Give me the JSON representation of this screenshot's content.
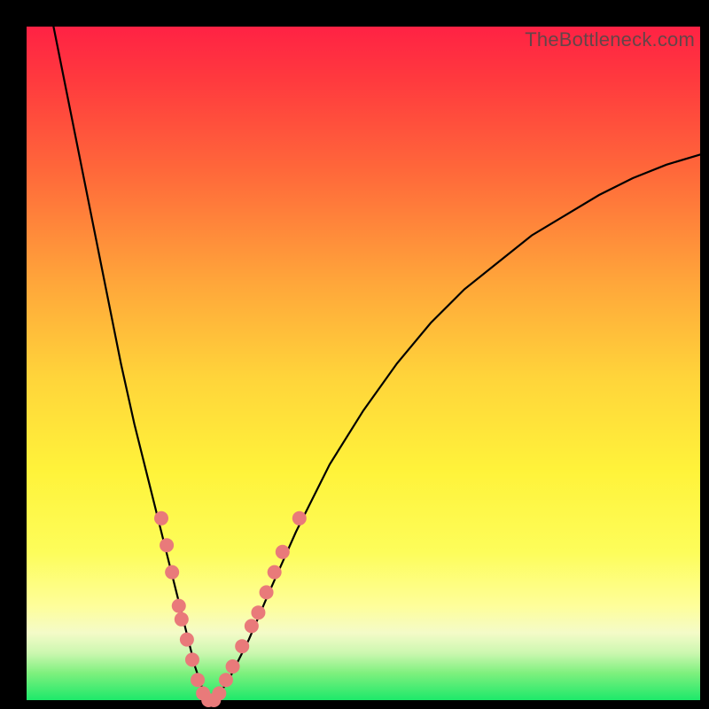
{
  "watermark": "TheBottleneck.com",
  "chart_data": {
    "type": "line",
    "title": "",
    "xlabel": "",
    "ylabel": "",
    "xlim": [
      0,
      100
    ],
    "ylim": [
      0,
      100
    ],
    "grid": false,
    "legend": false,
    "series": [
      {
        "name": "bottleneck-curve",
        "color": "#000000",
        "x": [
          4,
          6,
          8,
          10,
          12,
          14,
          16,
          18,
          20,
          21,
          22,
          23,
          24,
          25,
          26,
          27,
          28,
          30,
          33,
          36,
          40,
          45,
          50,
          55,
          60,
          65,
          70,
          75,
          80,
          85,
          90,
          95,
          100
        ],
        "y": [
          100,
          90,
          80,
          70,
          60,
          50,
          41,
          33,
          25,
          21,
          17,
          13,
          9,
          5,
          2,
          0,
          0,
          3,
          9,
          16,
          25,
          35,
          43,
          50,
          56,
          61,
          65,
          69,
          72,
          75,
          77.5,
          79.5,
          81
        ]
      }
    ],
    "markers": [
      {
        "name": "data-dots",
        "color": "#e97a7a",
        "radius": 8,
        "points": [
          {
            "x": 20.0,
            "y": 27
          },
          {
            "x": 20.8,
            "y": 23
          },
          {
            "x": 21.6,
            "y": 19
          },
          {
            "x": 22.6,
            "y": 14
          },
          {
            "x": 23.0,
            "y": 12
          },
          {
            "x": 23.8,
            "y": 9
          },
          {
            "x": 24.6,
            "y": 6
          },
          {
            "x": 25.4,
            "y": 3
          },
          {
            "x": 26.2,
            "y": 1
          },
          {
            "x": 27.0,
            "y": 0
          },
          {
            "x": 27.8,
            "y": 0
          },
          {
            "x": 28.6,
            "y": 1
          },
          {
            "x": 29.6,
            "y": 3
          },
          {
            "x": 30.6,
            "y": 5
          },
          {
            "x": 32.0,
            "y": 8
          },
          {
            "x": 33.4,
            "y": 11
          },
          {
            "x": 34.4,
            "y": 13
          },
          {
            "x": 35.6,
            "y": 16
          },
          {
            "x": 36.8,
            "y": 19
          },
          {
            "x": 38.0,
            "y": 22
          },
          {
            "x": 40.5,
            "y": 27
          }
        ]
      }
    ]
  }
}
